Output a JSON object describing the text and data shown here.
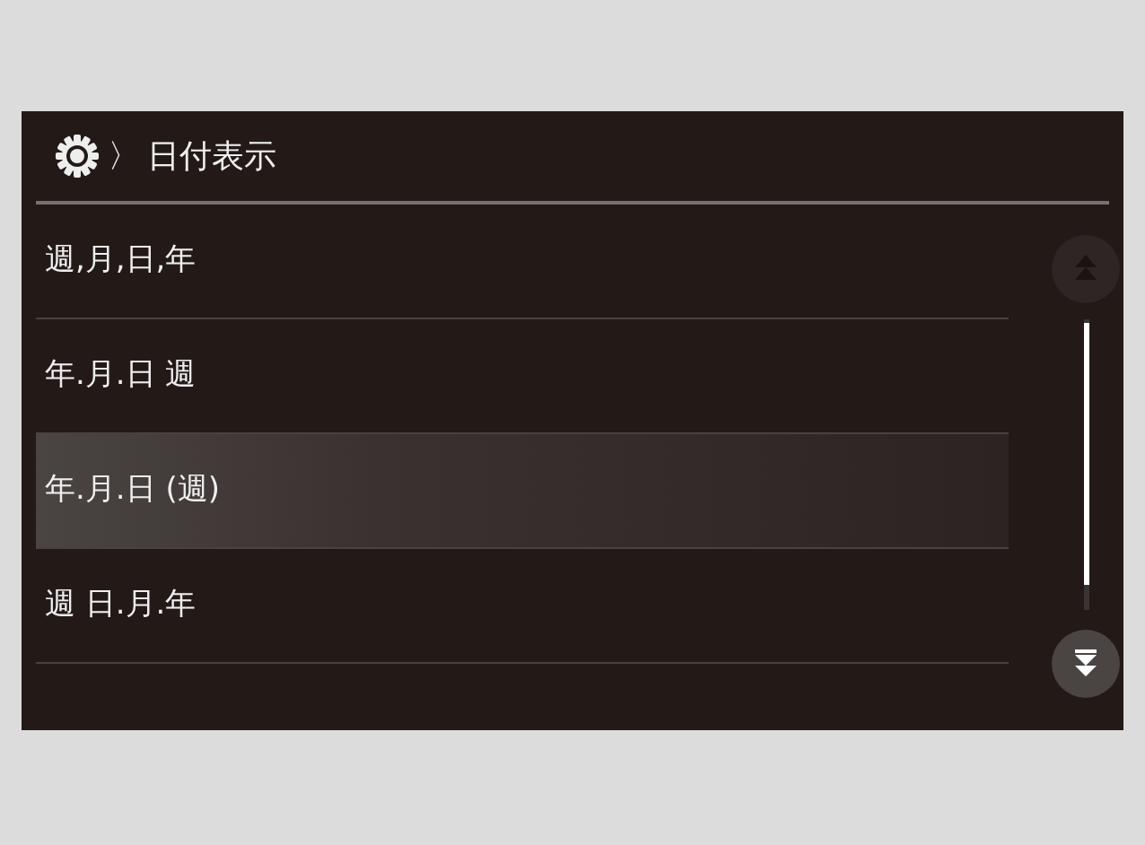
{
  "header": {
    "breadcrumb_separator": "〉",
    "title": "日付表示"
  },
  "items": [
    {
      "label": "週,月,日,年",
      "selected": false
    },
    {
      "label": "年.月.日 週",
      "selected": false
    },
    {
      "label": "年.月.日 (週)",
      "selected": true
    },
    {
      "label": "週 日.月.年",
      "selected": false
    }
  ],
  "scroll_buttons": [
    {
      "kind": "up",
      "disabled": true
    },
    {
      "kind": "down",
      "disabled": false
    }
  ]
}
